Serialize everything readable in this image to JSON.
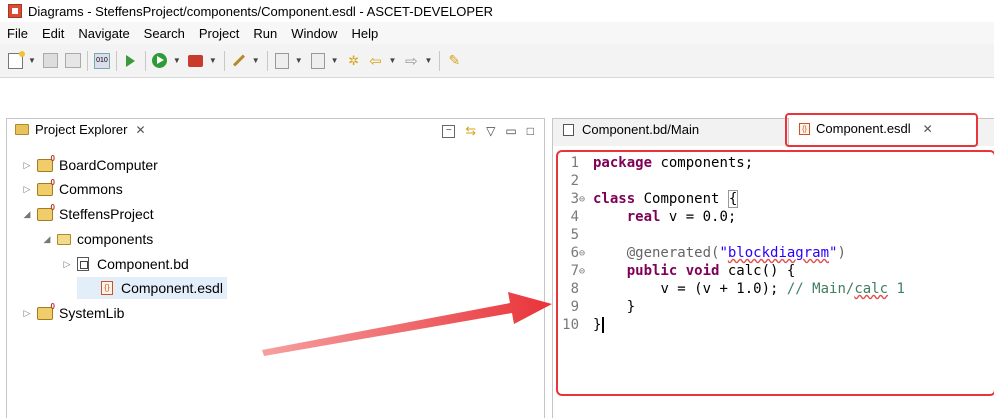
{
  "window": {
    "title": "Diagrams - SteffensProject/components/Component.esdl - ASCET-DEVELOPER"
  },
  "menu": [
    "File",
    "Edit",
    "Navigate",
    "Search",
    "Project",
    "Run",
    "Window",
    "Help"
  ],
  "toolbar_icons": [
    "new-icon",
    "save-icon",
    "save-all-icon",
    "binary-icon",
    "debug-run-icon",
    "run-icon",
    "external-tools-icon",
    "wand-icon",
    "next-annotation-icon",
    "prev-annotation-icon",
    "last-edit-icon",
    "back-icon",
    "forward-icon",
    "pen-icon"
  ],
  "explorer": {
    "tab_label": "Project Explorer",
    "close_glyph": "✕",
    "tree": [
      {
        "label": "BoardComputer",
        "level": 0,
        "expanded": false,
        "icon": "project-icon"
      },
      {
        "label": "Commons",
        "level": 0,
        "expanded": false,
        "icon": "project-icon"
      },
      {
        "label": "SteffensProject",
        "level": 0,
        "expanded": true,
        "icon": "project-icon"
      },
      {
        "label": "components",
        "level": 1,
        "expanded": true,
        "icon": "folder-icon"
      },
      {
        "label": "Component.bd",
        "level": 2,
        "expanded": false,
        "icon": "blockdiagram-file-icon"
      },
      {
        "label": "Component.esdl",
        "level": 2,
        "expanded": null,
        "icon": "esdl-file-icon",
        "selected": true
      },
      {
        "label": "SystemLib",
        "level": 0,
        "expanded": false,
        "icon": "project-icon"
      }
    ]
  },
  "editor": {
    "tabs": [
      {
        "label": "Component.bd/Main",
        "active": false
      },
      {
        "label": "Component.esdl",
        "active": true,
        "close_glyph": "✕"
      }
    ],
    "line_numbers": [
      "1",
      "2",
      "3",
      "4",
      "5",
      "6",
      "7",
      "8",
      "9",
      "10"
    ],
    "code": {
      "l1_kw": "package",
      "l1_rest": " components;",
      "l3_kw": "class",
      "l3_rest": " Component ",
      "l3_brace": "{",
      "l4_kw": "real",
      "l4_rest": " v = 0.0;",
      "l6_ann": "@generated(",
      "l6_str_q1": "\"",
      "l6_str_word": "blockdiagram",
      "l6_str_q2": "\"",
      "l6_close": ")",
      "l7_kw1": "public",
      "l7_kw2": "void",
      "l7_rest": " calc() {",
      "l8_code": "v = (v + 1.0); ",
      "l8_cm1": "// Main/",
      "l8_cm_sq": "calc",
      "l8_cm2": " 1",
      "l9": "}",
      "l10": "}"
    }
  },
  "annotation_color": "#e8343a"
}
